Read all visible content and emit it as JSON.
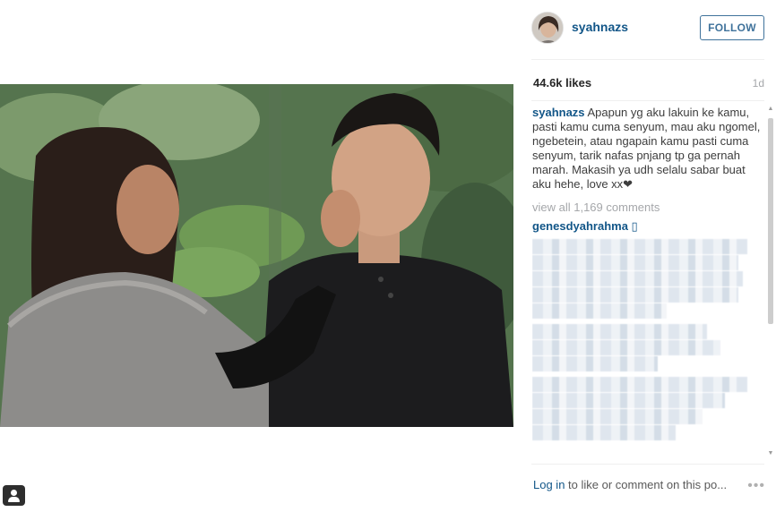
{
  "post": {
    "username": "syahnazs",
    "follow_label": "FOLLOW",
    "likes": "44.6k likes",
    "age": "1d",
    "caption": "Apapun yg aku lakuin ke kamu, pasti kamu cuma senyum, mau aku ngomel, ngebetein, atau ngapain kamu pasti cuma senyum, tarik nafas pnjang tp ga pernah marah. Makasih ya udh selalu sabar buat aku hehe, love xx❤",
    "view_all": "view all 1,169 comments",
    "first_commenter": "genesdyahrahma ▯",
    "footer": {
      "login_label": "Log in",
      "rest": " to like or comment on this po...",
      "more_icon": "•••"
    }
  },
  "icons": {
    "avatar": "avatar",
    "user_tag": "user-tag-icon",
    "more": "more-options-icon"
  },
  "colors": {
    "link_blue": "#125688",
    "follow_blue": "#3f729b",
    "muted_gray": "#a5a7aa"
  }
}
